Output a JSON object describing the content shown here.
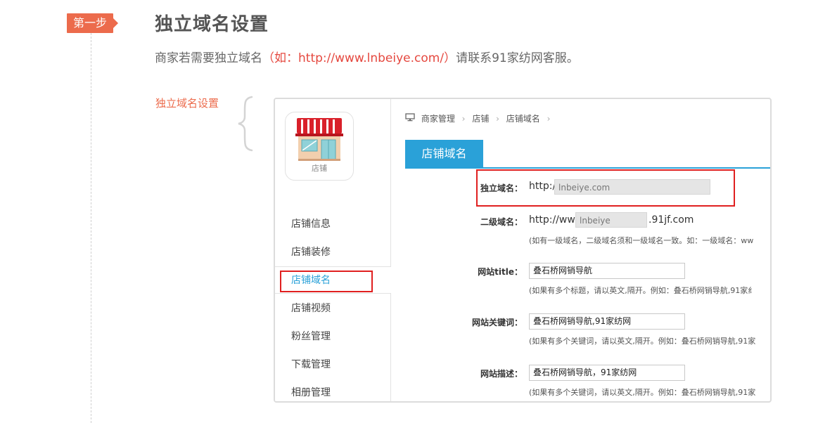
{
  "step": {
    "badge": "第一步",
    "title": "独立域名设置",
    "desc_before": "商家若需要独立域名",
    "desc_highlight": "（如：http://www.lnbeiye.com/）",
    "desc_after": "请联系91家纺网客服。"
  },
  "side_label": "独立域名设置",
  "app": {
    "shop_tile_label": "店铺",
    "nav": [
      {
        "label": "店铺信息",
        "active": false
      },
      {
        "label": "店铺装修",
        "active": false
      },
      {
        "label": "店铺域名",
        "active": true
      },
      {
        "label": "店铺视频",
        "active": false
      },
      {
        "label": "粉丝管理",
        "active": false
      },
      {
        "label": "下载管理",
        "active": false
      },
      {
        "label": "相册管理",
        "active": false
      }
    ],
    "breadcrumb": [
      "商家管理",
      "店铺",
      "店铺域名"
    ],
    "breadcrumb_sep": "›",
    "tab": "店铺域名",
    "form": {
      "domain": {
        "label": "独立域名：",
        "prefix": "http://",
        "value": "lnbeiye.com"
      },
      "subdomain": {
        "label": "二级域名：",
        "prefix": "http://www.",
        "value": "lnbeiye",
        "suffix": ".91jf.com",
        "hint": "(如有一级域名，二级域名须和一级域名一致。如：一级域名：ww"
      },
      "title": {
        "label": "网站title：",
        "value": "叠石桥网销导航",
        "hint": "(如果有多个标题，请以英文,隔开。例如：叠石桥网销导航,91家纟"
      },
      "keywords": {
        "label": "网站关键词：",
        "value": "叠石桥网销导航,91家纺网",
        "hint": "(如果有多个关键词，请以英文,隔开。例如：叠石桥网销导航,91家"
      },
      "description": {
        "label": "网站描述：",
        "value": "叠石桥网销导航，91家纺网",
        "hint": "(如果有多个关键词，请以英文,隔开。例如：叠石桥网销导航,91家"
      }
    }
  },
  "colors": {
    "accent": "#2aa1d8",
    "step": "#ec6b4c",
    "highlight_red": "#e02020"
  }
}
